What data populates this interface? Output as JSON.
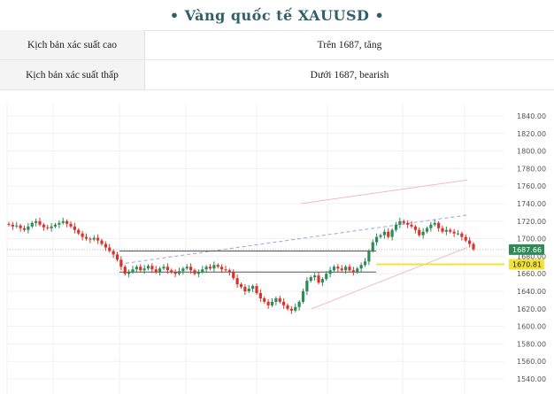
{
  "header": {
    "title": "• Vàng quốc tế XAUUSD •"
  },
  "scenarios": [
    {
      "label": "Kịch bản xác suất cao",
      "value": "Trên 1687, tăng"
    },
    {
      "label": "Kịch bản xác suất thấp",
      "value": "Dưới 1687, bearish"
    }
  ],
  "chart_data": {
    "type": "candlestick",
    "title": "",
    "xlabel": "",
    "ylabel": "",
    "ylim": [
      1535,
      1850
    ],
    "y_ticks": [
      "1840.00",
      "1820.00",
      "1800.00",
      "1780.00",
      "1760.00",
      "1740.00",
      "1720.00",
      "1700.00",
      "1680.00",
      "1660.00",
      "1640.00",
      "1620.00",
      "1600.00",
      "1580.00",
      "1560.00",
      "1540.00"
    ],
    "price_tags": [
      {
        "label": "1687.66",
        "value": 1687.66,
        "color": "#2e8b57"
      },
      {
        "label": "1670.81",
        "value": 1670.81,
        "color": "#f2e23a"
      }
    ],
    "closes": [
      1716,
      1714,
      1715,
      1712,
      1710,
      1714,
      1718,
      1720,
      1716,
      1713,
      1712,
      1714,
      1716,
      1718,
      1720,
      1717,
      1714,
      1710,
      1706,
      1702,
      1700,
      1699,
      1701,
      1698,
      1694,
      1690,
      1686,
      1682,
      1676,
      1668,
      1660,
      1662,
      1665,
      1668,
      1664,
      1666,
      1669,
      1665,
      1662,
      1666,
      1668,
      1664,
      1662,
      1660,
      1663,
      1666,
      1668,
      1664,
      1660,
      1662,
      1665,
      1668,
      1666,
      1670,
      1668,
      1665,
      1664,
      1662,
      1655,
      1648,
      1645,
      1640,
      1643,
      1646,
      1638,
      1632,
      1628,
      1624,
      1628,
      1632,
      1628,
      1624,
      1620,
      1618,
      1622,
      1628,
      1640,
      1652,
      1656,
      1658,
      1650,
      1654,
      1660,
      1664,
      1668,
      1666,
      1664,
      1668,
      1664,
      1662,
      1666,
      1670,
      1674,
      1686,
      1696,
      1702,
      1704,
      1708,
      1702,
      1710,
      1716,
      1720,
      1718,
      1716,
      1714,
      1710,
      1704,
      1708,
      1712,
      1716,
      1718,
      1712,
      1708,
      1710,
      1708,
      1706,
      1706,
      1702,
      1698,
      1694,
      1688
    ],
    "support_zone": [
      1686,
      1662
    ],
    "channel_upper": [
      [
        1740,
        1700
      ],
      [
        1765,
        1767
      ]
    ],
    "channel_lower": [
      [
        1620,
        1624
      ],
      [
        1688,
        1690
      ]
    ],
    "grid": true
  }
}
